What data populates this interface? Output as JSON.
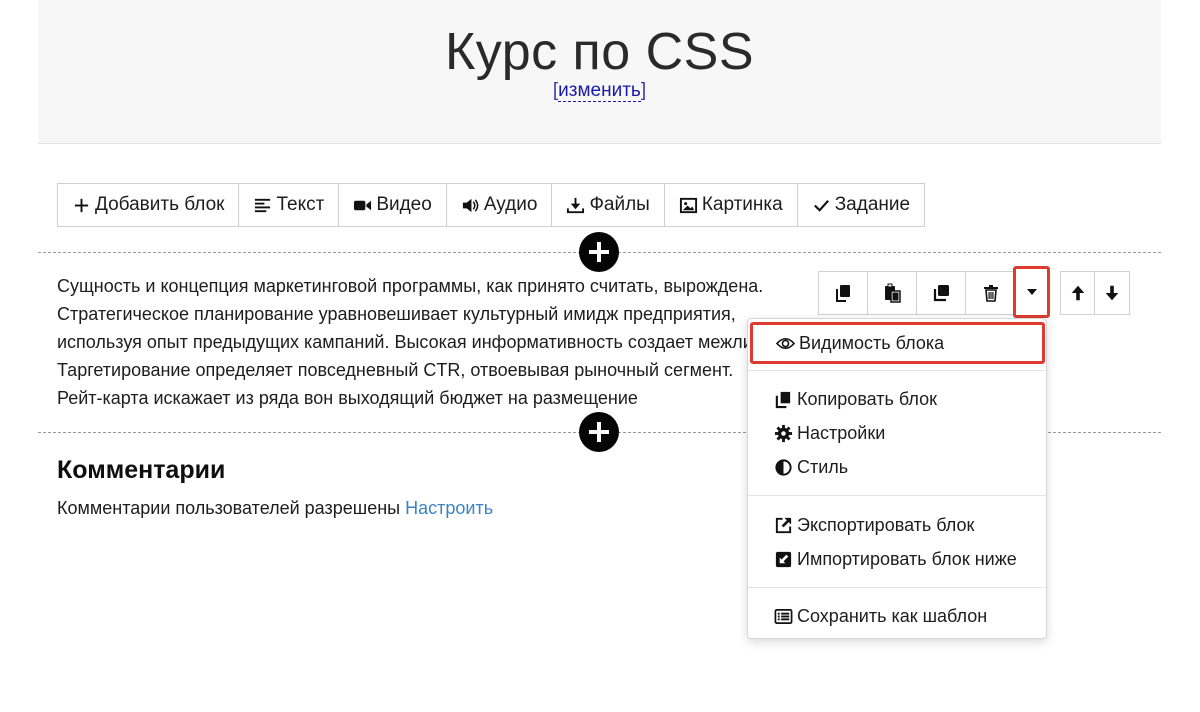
{
  "header": {
    "title": "Курс по CSS",
    "edit_link": "изменить",
    "bracket_open": "[",
    "bracket_close": "]"
  },
  "toolbar": {
    "items": [
      {
        "label": "Добавить блок",
        "icon": "plus-icon"
      },
      {
        "label": "Текст",
        "icon": "align-left-icon"
      },
      {
        "label": "Видео",
        "icon": "video-camera-icon"
      },
      {
        "label": "Аудио",
        "icon": "volume-icon"
      },
      {
        "label": "Файлы",
        "icon": "download-icon"
      },
      {
        "label": "Картинка",
        "icon": "image-icon"
      },
      {
        "label": "Задание",
        "icon": "check-icon"
      }
    ]
  },
  "block": {
    "lines": [
      "Сущность и концепция маркетинговой программы, как принято считать, вырождена.",
      "Стратегическое планирование уравновешивает культурный имидж предприятия,",
      "используя опыт предыдущих кампаний. Высокая информативность создает межличностный",
      "Таргетирование определяет повседневный CTR, отвоевывая рыночный сегмент.",
      "Рейт-карта искажает из ряда вон выходящий бюджет на размещение"
    ],
    "actions": [
      "copy-icon",
      "paste-icon",
      "duplicate-icon",
      "trash-icon"
    ],
    "move": [
      "arrow-up-icon",
      "arrow-down-icon"
    ]
  },
  "comments": {
    "title": "Комментарии",
    "text": "Комментарии пользователей разрешены",
    "link": "Настроить"
  },
  "menu": {
    "visibility": "Видимость блока",
    "copy": "Копировать блок",
    "settings": "Настройки",
    "style": "Стиль",
    "export": "Экспортировать блок",
    "import": "Импортировать блок ниже",
    "save_template": "Сохранить как шаблон"
  },
  "colors": {
    "highlight": "#dd3b2f",
    "link": "#3c82c4",
    "header_bg": "#f7f7f7"
  }
}
